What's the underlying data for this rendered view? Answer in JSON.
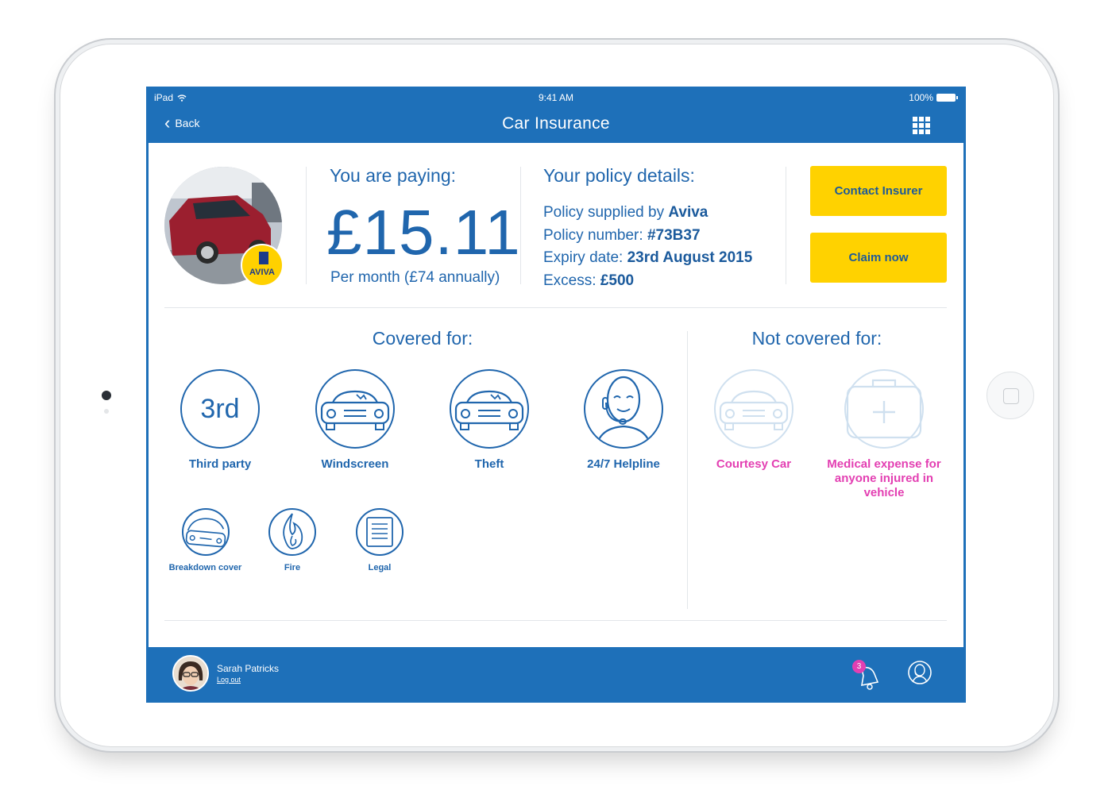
{
  "status": {
    "device": "iPad",
    "time": "9:41 AM",
    "battery": "100%"
  },
  "nav": {
    "back_label": "Back",
    "title": "Car Insurance"
  },
  "summary": {
    "paying_label": "You are paying:",
    "amount": "£15.11",
    "per_month": "Per month (£74 annually)",
    "insurer_logo_text": "AVIVA",
    "policy_heading": "Your policy details:",
    "policy": [
      {
        "label": "Policy supplied by ",
        "value": "Aviva"
      },
      {
        "label": "Policy number: ",
        "value": "#73B37"
      },
      {
        "label": "Expiry date: ",
        "value": "23rd August 2015"
      },
      {
        "label": "Excess: ",
        "value": "£500"
      }
    ],
    "contact_button": "Contact Insurer",
    "claim_button": "Claim now"
  },
  "covered": {
    "title": "Covered for:",
    "third_party_badge": "3rd",
    "items": [
      "Third party",
      "Windscreen",
      "Theft",
      "24/7 Helpline"
    ],
    "small_items": [
      "Breakdown cover",
      "Fire",
      "Legal"
    ]
  },
  "not_covered": {
    "title": "Not covered for:",
    "items": [
      "Courtesy Car",
      "Medical expense for anyone injured in vehicle"
    ]
  },
  "footer": {
    "user_name": "Sarah Patricks",
    "logout": "Log out",
    "notification_count": "3"
  },
  "colors": {
    "brand_blue": "#1e70b9",
    "text_blue": "#2066ad",
    "yellow": "#ffd200",
    "pink": "#e33fb2"
  },
  "icons": [
    "back-chevron-icon",
    "apps-grid-icon",
    "third-party-icon",
    "car-windscreen-icon",
    "car-theft-icon",
    "helpline-agent-icon",
    "breakdown-car-icon",
    "fire-icon",
    "legal-document-icon",
    "courtesy-car-icon",
    "medical-kit-icon",
    "bell-icon",
    "support-agent-icon"
  ]
}
